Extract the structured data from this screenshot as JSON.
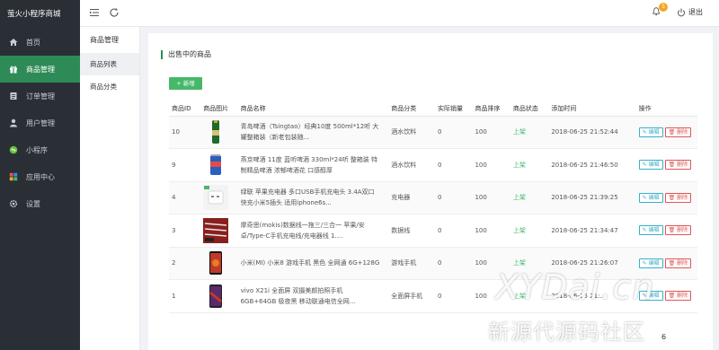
{
  "brand": "萤火小程序商城",
  "nav": [
    {
      "label": "首页",
      "icon": "home-icon"
    },
    {
      "label": "商品管理",
      "icon": "gift-icon"
    },
    {
      "label": "订单管理",
      "icon": "order-list-icon"
    },
    {
      "label": "用户管理",
      "icon": "user-icon"
    },
    {
      "label": "小程序",
      "icon": "miniprogram-icon"
    },
    {
      "label": "应用中心",
      "icon": "apps-icon"
    },
    {
      "label": "设置",
      "icon": "gear-icon"
    }
  ],
  "nav_active": "商品管理",
  "topbar": {
    "notification_count": "5",
    "logout_label": "退出"
  },
  "subnav": {
    "title": "商品管理",
    "items": [
      {
        "label": "商品列表"
      },
      {
        "label": "商品分类"
      }
    ]
  },
  "main": {
    "title": "出售中的商品",
    "add_button": "+ 新增",
    "columns": [
      "商品ID",
      "商品图片",
      "商品名称",
      "商品分类",
      "实际销量",
      "商品排序",
      "商品状态",
      "添加时间",
      "操作"
    ],
    "edit_label": "编辑",
    "delete_label": "删除",
    "rows": [
      {
        "id": "10",
        "image": "beer-bottle",
        "name": "青岛啤酒（Tsingtao）经典10度 500ml*12听 大罐整箱装（新老包装随...",
        "category": "酒水饮料",
        "sales": "0",
        "sort": "100",
        "status": "上架",
        "time": "2018-06-25 21:52:44"
      },
      {
        "id": "9",
        "image": "beer-can",
        "name": "燕京啤酒 11度 蓝听啤酒 330ml*24听 整箱装 特制精品啤酒 浓郁啤酒花 口感醇厚",
        "category": "酒水饮料",
        "sales": "0",
        "sort": "100",
        "status": "上架",
        "time": "2018-06-25 21:46:50"
      },
      {
        "id": "4",
        "image": "charger",
        "name": "绿联 苹果充电器 多口USB手机充电头 3.4A双口快充小米5插头 适用iphone6s...",
        "category": "充电器",
        "sales": "0",
        "sort": "100",
        "status": "上架",
        "time": "2018-06-25 21:39:25"
      },
      {
        "id": "3",
        "image": "cables",
        "name": "摩奇思(mokis)数据线一拖三/三合一 苹果/安卓/Type-C手机充电线/充电器线 1....",
        "category": "数据线",
        "sales": "0",
        "sort": "100",
        "status": "上架",
        "time": "2018-06-25 21:34:47"
      },
      {
        "id": "2",
        "image": "phone-red",
        "name": "小米(MI) 小米8 游戏手机 黑色 全网通 6G+128G",
        "category": "游戏手机",
        "sales": "0",
        "sort": "100",
        "status": "上架",
        "time": "2018-06-25 21:26:07"
      },
      {
        "id": "1",
        "image": "phone-vivo",
        "name": "vivo X21i 全面屏 双摄美颜拍照手机 6GB+64GB 极夜黑 移动联通电信全网...",
        "category": "全面屏手机",
        "sales": "0",
        "sort": "100",
        "status": "上架",
        "time": "2018-06-25 21:..."
      }
    ],
    "pager_text": "6"
  },
  "watermark": {
    "line1": "XYDai.cn",
    "line2": "新源代源码社区"
  },
  "colors": {
    "sidebar_bg": "#2a2f36",
    "active_green": "#2e8b57",
    "add_button": "#47b86a",
    "edit": "#3ab0c8",
    "delete": "#e35454",
    "badge": "#f5a623"
  }
}
